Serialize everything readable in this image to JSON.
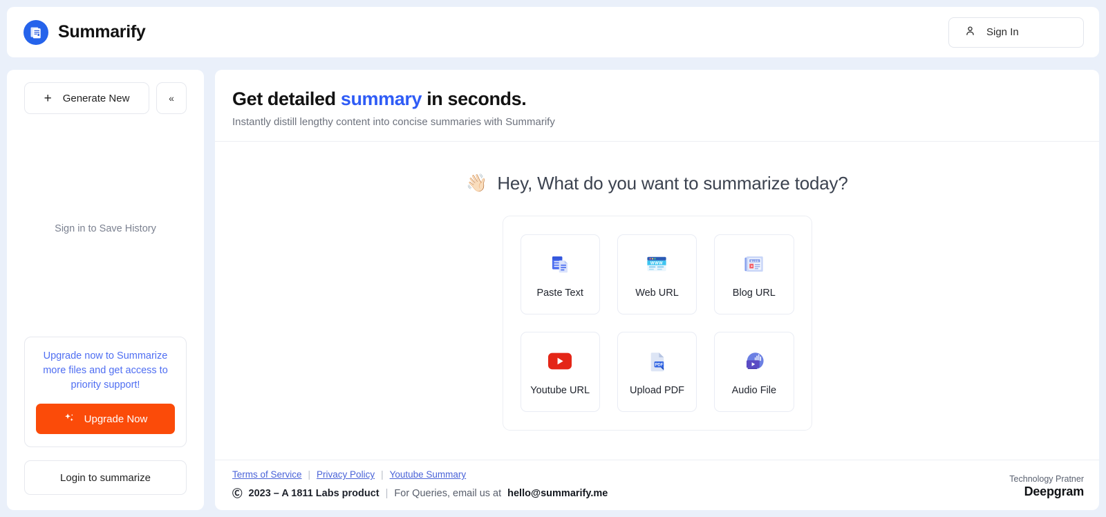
{
  "header": {
    "brand_name": "Summarify",
    "logo_icon": "document-logo-icon",
    "signin_label": "Sign In",
    "signin_icon": "user-icon"
  },
  "sidebar": {
    "generate_label": "Generate New",
    "generate_icon": "plus-icon",
    "collapse_icon": "double-chevron-left-icon",
    "collapse_label": "«",
    "history_hint": "Sign in to Save History",
    "upgrade_text": "Upgrade now to Summarize more files and get access to priority support!",
    "upgrade_button_label": "Upgrade Now",
    "upgrade_button_icon": "sparkles-icon",
    "upgrade_button_color": "#fb4b09",
    "login_label": "Login to summarize"
  },
  "main": {
    "title_part1": "Get detailed ",
    "title_accent": "summary",
    "title_part2": " in seconds.",
    "accent_color": "#2f5cf6",
    "subtitle": "Instantly distill lengthy content into concise summaries with Summarify",
    "greeting_emoji": "👋🏻",
    "greeting": "Hey, What do you want to summarize today?",
    "options": [
      {
        "label": "Paste Text",
        "icon": "paste-text-icon"
      },
      {
        "label": "Web URL",
        "icon": "web-url-icon"
      },
      {
        "label": "Blog URL",
        "icon": "blog-url-icon"
      },
      {
        "label": "Youtube URL",
        "icon": "youtube-icon"
      },
      {
        "label": "Upload PDF",
        "icon": "pdf-file-icon"
      },
      {
        "label": "Audio File",
        "icon": "audio-file-icon"
      }
    ]
  },
  "footer": {
    "links": [
      {
        "label": "Terms of Service"
      },
      {
        "label": "Privacy Policy"
      },
      {
        "label": "Youtube Summary"
      }
    ],
    "separator": "|",
    "copyright_symbol": "Ⓒ",
    "copyright_text": "2023 – A 1811 Labs product",
    "queries_text": "For Queries, email us at",
    "email": "hello@summarify.me",
    "partner_label": "Technology Pratner",
    "partner_name": "Deepgram"
  }
}
